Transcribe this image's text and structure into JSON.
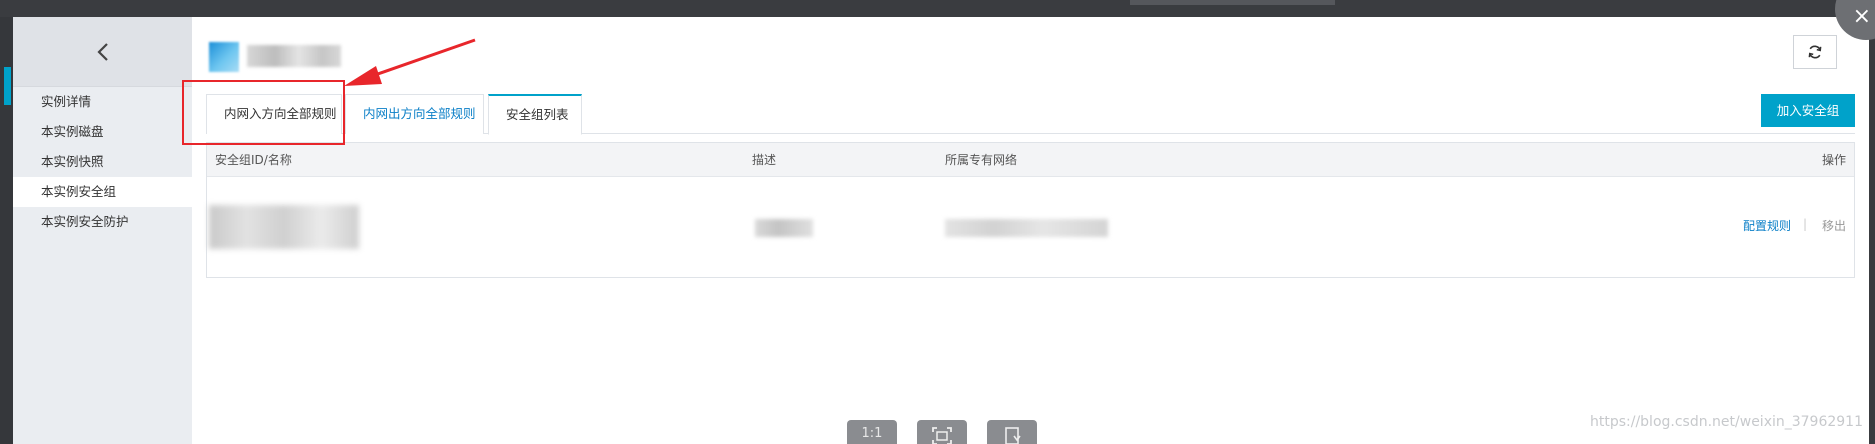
{
  "sidebar": {
    "back_icon": "chevron-left-icon",
    "items": [
      {
        "label": "实例详情"
      },
      {
        "label": "本实例磁盘"
      },
      {
        "label": "本实例快照"
      },
      {
        "label": "本实例安全组",
        "active": true
      },
      {
        "label": "本实例安全防护"
      }
    ]
  },
  "header": {
    "refresh_icon": "refresh-icon"
  },
  "tabs": [
    {
      "label": "内网入方向全部规则"
    },
    {
      "label": "内网出方向全部规则"
    },
    {
      "label": "安全组列表",
      "active": true
    }
  ],
  "actions": {
    "add_security_group": "加入安全组"
  },
  "table": {
    "columns": [
      "安全组ID/名称",
      "描述",
      "所属专有网络",
      "操作"
    ],
    "row_actions": {
      "configure": "配置规则",
      "separator": "|",
      "remove": "移出"
    }
  },
  "viewer_tools": {
    "actual_size": "1:1",
    "fit_icon": "fit-screen-icon",
    "rotate_icon": "rotate-icon"
  },
  "watermark": "https://blog.csdn.net/weixin_37962911",
  "colors": {
    "accent": "#00a2ca",
    "link": "#0b7fc7",
    "annotation": "#e8262b"
  }
}
